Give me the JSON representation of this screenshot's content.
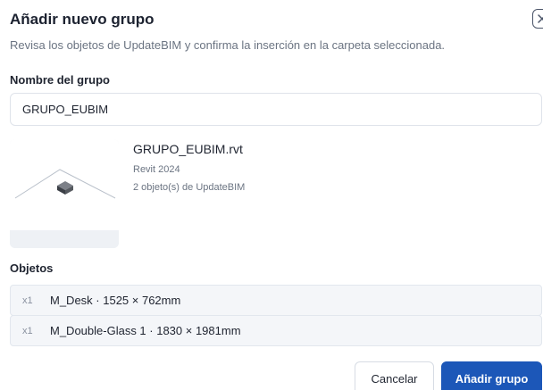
{
  "dialog": {
    "title": "Añadir nuevo grupo",
    "subtitle": "Revisa los objetos de UpdateBIM y confirma la inserción en la carpeta seleccionada.",
    "close_icon": "close-icon"
  },
  "group_name": {
    "label": "Nombre del grupo",
    "value": "GRUPO_EUBIM"
  },
  "file": {
    "name": "GRUPO_EUBIM.rvt",
    "version": "Revit 2024",
    "object_count": "2 objeto(s) de UpdateBIM"
  },
  "objects": {
    "label": "Objetos",
    "items": [
      {
        "qty": "x1",
        "name": "M_Desk · 1525 × 762mm"
      },
      {
        "qty": "x1",
        "name": "M_Double-Glass 1 · 1830 × 1981mm"
      }
    ]
  },
  "actions": {
    "cancel_label": "Cancelar",
    "add_label": "Añadir grupo"
  },
  "colors": {
    "primary": "#1c57b8",
    "muted_text": "#6b7482",
    "row_background": "#f4f6f9"
  }
}
